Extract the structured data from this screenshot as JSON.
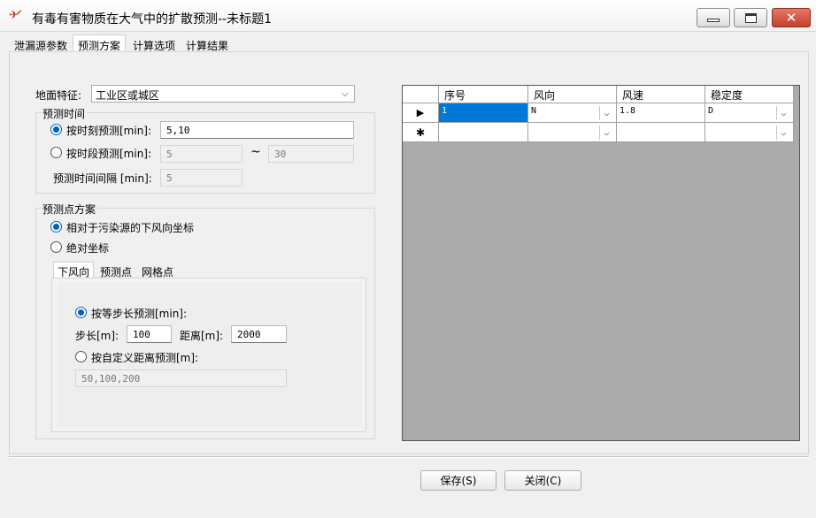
{
  "window": {
    "title": "有毒有害物质在大气中的扩散预测--未标题1",
    "icon": "app-logo-icon",
    "close_glyph": "✕"
  },
  "tabs": [
    {
      "label": "泄漏源参数"
    },
    {
      "label": "预测方案"
    },
    {
      "label": "计算选项"
    },
    {
      "label": "计算结果"
    }
  ],
  "terrain": {
    "label": "地面特征:",
    "value": "工业区或城区"
  },
  "forecast_time": {
    "group_title": "预测时间",
    "by_moment_label": "按时刻预测[min]:",
    "by_moment_value": "5,10",
    "by_period_label": "按时段预测[min]:",
    "period_from": "5",
    "tilde": "~",
    "period_to": "30",
    "interval_label": "预测时间间隔 [min]:",
    "interval_value": "5"
  },
  "forecast_points": {
    "group_title": "预测点方案",
    "relative_label": "相对于污染源的下风向坐标",
    "absolute_label": "绝对坐标",
    "subtabs": [
      {
        "label": "下风向"
      },
      {
        "label": "预测点"
      },
      {
        "label": "网格点"
      }
    ],
    "equal_step_label": "按等步长预测[min]:",
    "step_label": "步长[m]:",
    "step_value": "100",
    "distance_label": "距离[m]:",
    "distance_value": "2000",
    "custom_label": "按自定义距离预测[m]:",
    "custom_value": "50,100,200"
  },
  "grid": {
    "columns": [
      "序号",
      "风向",
      "风速",
      "稳定度"
    ],
    "rows": [
      {
        "marker": "▶",
        "seq": "1",
        "direction": "N",
        "speed": "1.8",
        "stability": "D"
      },
      {
        "marker": "✱",
        "seq": "",
        "direction": "",
        "speed": "",
        "stability": ""
      }
    ]
  },
  "buttons": {
    "save": "保存(S)",
    "close": "关闭(C)"
  }
}
